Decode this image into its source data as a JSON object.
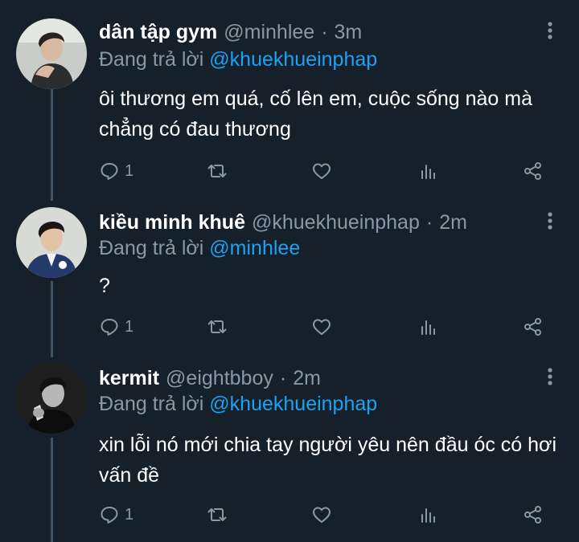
{
  "reply_prefix": "Đang trả lời",
  "colors": {
    "background": "#15202b",
    "text": "#ffffff",
    "secondary": "#8899a6",
    "mention": "#1da1f2",
    "thread_line": "#3d5466"
  },
  "tweets": [
    {
      "name": "dân tập gym",
      "handle": "@minhlee",
      "separator": "·",
      "time": "3m",
      "reply_prefix": "Đang trả lời",
      "reply_to": "@khuekhueinphap",
      "text": "ôi thương em quá, cố lên em, cuộc sống nào mà chẳng có đau thương",
      "reply_count": "1"
    },
    {
      "name": "kiều minh khuê",
      "handle": "@khuekhueinphap",
      "separator": "·",
      "time": "2m",
      "reply_prefix": "Đang trả lời",
      "reply_to": "@minhlee",
      "text": "?",
      "reply_count": "1"
    },
    {
      "name": "kermit",
      "handle": "@eightbboy",
      "separator": "·",
      "time": "2m",
      "reply_prefix": "Đang trả lời",
      "reply_to": "@khuekhueinphap",
      "text": "xin lỗi nó mới chia tay người yêu nên đầu óc có hơi vấn đề",
      "reply_count": "1"
    }
  ],
  "icons": {
    "reply": "reply-icon",
    "retweet": "retweet-icon",
    "like": "heart-icon",
    "analytics": "analytics-icon",
    "share": "share-icon",
    "more": "more-vertical-icon"
  }
}
